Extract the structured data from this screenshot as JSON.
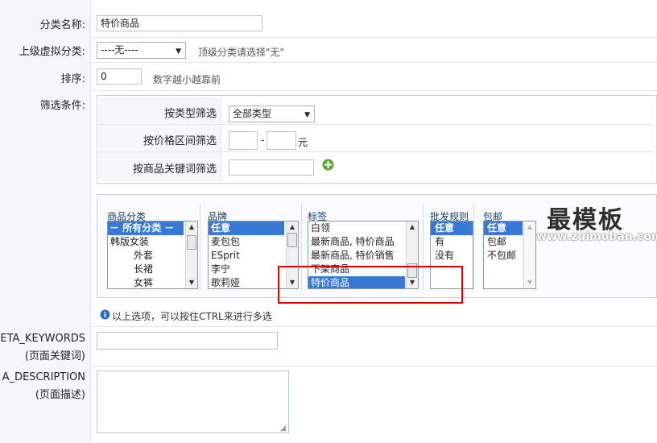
{
  "form": {
    "category_name": {
      "label": "分类名称:",
      "value": "特价商品"
    },
    "parent_category": {
      "label": "上级虚拟分类:",
      "selected": "----无----",
      "hint": "顶级分类请选择\"无\""
    },
    "sort": {
      "label": "排序:",
      "value": "0",
      "hint": "数字越小越靠前"
    },
    "filter": {
      "label": "筛选条件:",
      "by_type": {
        "label": "按类型筛选",
        "selected": "全部类型"
      },
      "by_price": {
        "label": "按价格区间筛选",
        "separator": "-",
        "unit": "元",
        "min": "",
        "max": ""
      },
      "by_keyword": {
        "label": "按商品关键词筛选",
        "value": ""
      }
    },
    "lists": {
      "category": {
        "title": "商品分类",
        "items": [
          "－ 所有分类 －",
          "韩版女装",
          "外套",
          "长裙",
          "女裤"
        ]
      },
      "brand": {
        "title": "品牌",
        "items": [
          "任意",
          "麦包包",
          "ESprit",
          "李宁",
          "歌莉娅"
        ]
      },
      "tag": {
        "title": "标签",
        "items": [
          "白领",
          "最新商品, 特价商品",
          "最新商品, 特价销售",
          "下架商品",
          "特价商品"
        ]
      },
      "wholesale": {
        "title": "批发规则",
        "items": [
          "任意",
          "有",
          "没有"
        ]
      },
      "shipping": {
        "title": "包邮",
        "items": [
          "任意",
          "包邮",
          "不包邮"
        ]
      }
    },
    "multi_select_hint": "以上选项，可以按住CTRL来进行多选",
    "meta_keywords": {
      "label_line1": "ETA_KEYWORDS",
      "label_line2": "(页面关键词)",
      "value": ""
    },
    "meta_description": {
      "label_line1": "A_DESCRIPTION",
      "label_line2": "(页面描述)",
      "value": ""
    }
  },
  "watermark": {
    "main": "最模板",
    "url": "www.zuimoban.com"
  },
  "colors": {
    "selection": "#3878d8",
    "highlight_box": "#e00000"
  }
}
